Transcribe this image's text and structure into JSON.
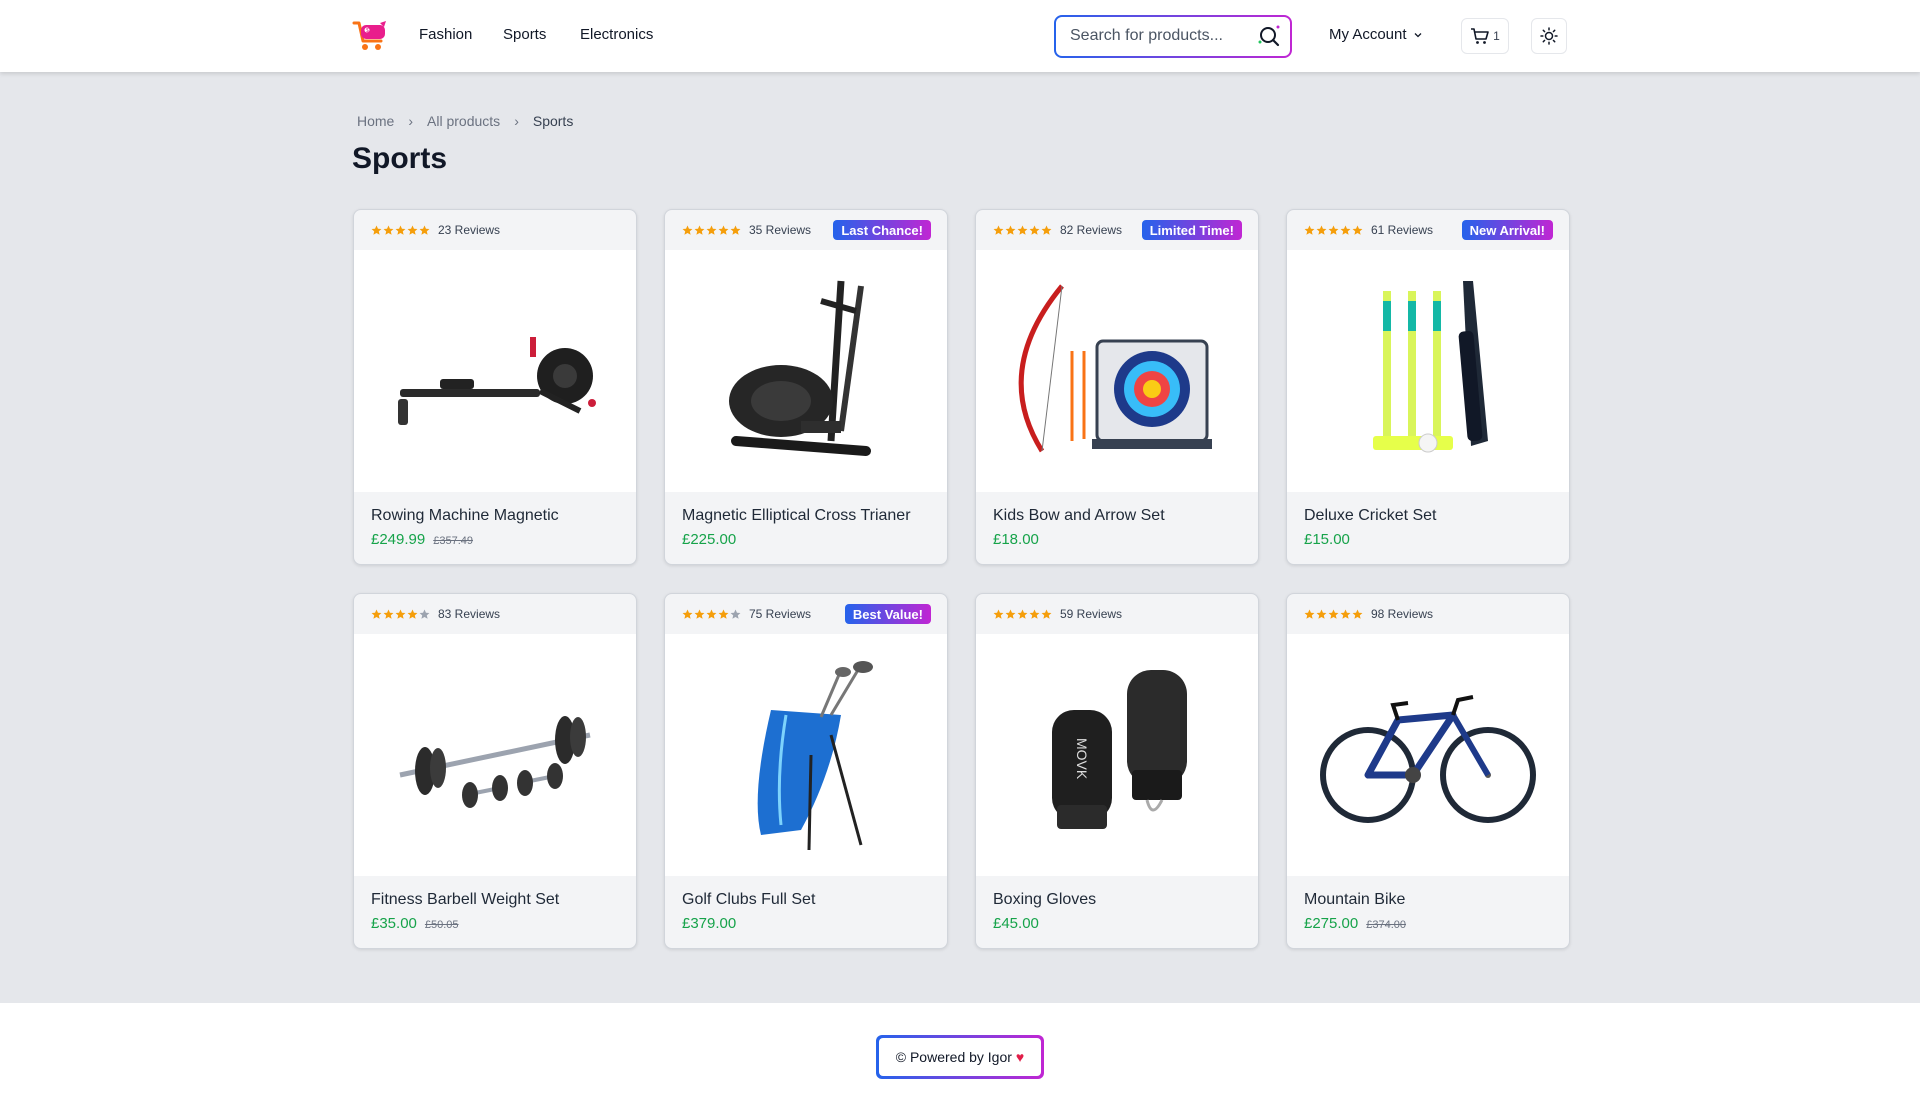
{
  "header": {
    "logo_icon": "shopping-cart-logo-icon",
    "nav": [
      "Fashion",
      "Sports",
      "Electronics"
    ],
    "search_placeholder": "Search for products...",
    "search_icon": "search-icon",
    "account_label": "My Account",
    "cart_count": "1",
    "theme_icon": "sun-icon"
  },
  "breadcrumb": [
    "Home",
    "All products",
    "Sports"
  ],
  "page_title": "Sports",
  "colors": {
    "accent_blue": "#2563eb",
    "accent_magenta": "#c026d3",
    "price_green": "#16a34a",
    "star_gold": "#f59e0b"
  },
  "products": [
    {
      "name": "Rowing Machine Magnetic",
      "price": "£249.99",
      "old_price": "£357.49",
      "reviews": "23 Reviews",
      "rating": 5,
      "badge": "",
      "icon": "rowing-machine-image"
    },
    {
      "name": "Magnetic Elliptical Cross Trianer",
      "price": "£225.00",
      "old_price": "",
      "reviews": "35 Reviews",
      "rating": 5,
      "badge": "Last Chance!",
      "icon": "elliptical-trainer-image"
    },
    {
      "name": "Kids Bow and Arrow Set",
      "price": "£18.00",
      "old_price": "",
      "reviews": "82 Reviews",
      "rating": 5,
      "badge": "Limited Time!",
      "icon": "bow-arrow-set-image"
    },
    {
      "name": "Deluxe Cricket Set",
      "price": "£15.00",
      "old_price": "",
      "reviews": "61 Reviews",
      "rating": 5,
      "badge": "New Arrival!",
      "icon": "cricket-set-image"
    },
    {
      "name": "Fitness Barbell Weight Set",
      "price": "£35.00",
      "old_price": "£50.05",
      "reviews": "83 Reviews",
      "rating": 4,
      "badge": "",
      "icon": "barbell-set-image"
    },
    {
      "name": "Golf Clubs Full Set",
      "price": "£379.00",
      "old_price": "",
      "reviews": "75 Reviews",
      "rating": 4,
      "badge": "Best Value!",
      "icon": "golf-bag-image"
    },
    {
      "name": "Boxing Gloves",
      "price": "£45.00",
      "old_price": "",
      "reviews": "59 Reviews",
      "rating": 5,
      "badge": "",
      "icon": "boxing-gloves-image"
    },
    {
      "name": "Mountain Bike",
      "price": "£275.00",
      "old_price": "£374.00",
      "reviews": "98 Reviews",
      "rating": 5,
      "badge": "",
      "icon": "mountain-bike-image"
    }
  ],
  "footer": {
    "powered_text": "© Powered by Igor",
    "heart_icon": "heart-icon"
  }
}
